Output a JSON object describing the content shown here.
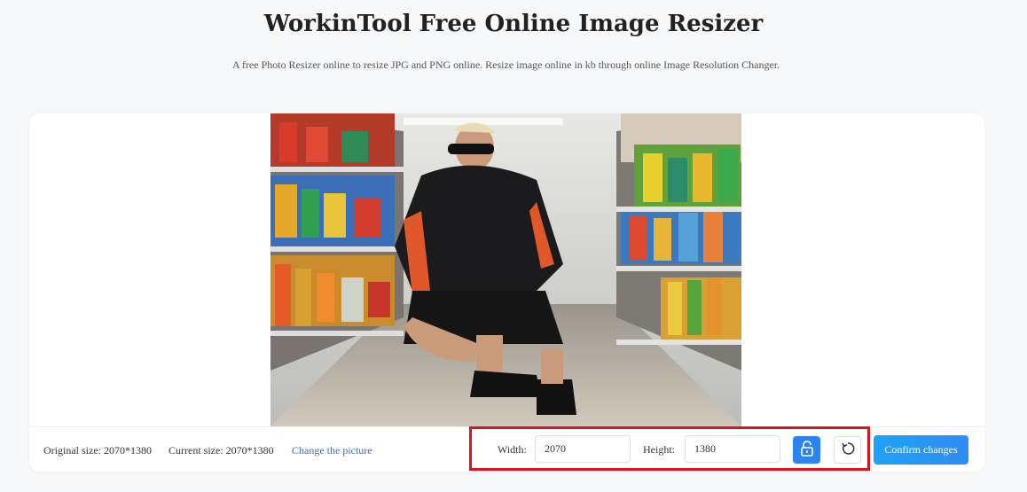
{
  "header": {
    "title": "WorkinTool Free Online Image Resizer",
    "subtitle": "A free Photo Resizer online to resize JPG and PNG online. Resize image online in kb through online Image Resolution Changer."
  },
  "preview": {
    "image_icon": "photo-preview"
  },
  "info": {
    "original_size": "Original size: 2070*1380",
    "current_size": "Current size: 2070*1380",
    "change_picture": "Change the picture"
  },
  "controls": {
    "width_label": "Width:",
    "width_value": "2070",
    "height_label": "Height:",
    "height_value": "1380",
    "lock_icon": "lock-icon",
    "reset_icon": "reset-icon",
    "confirm_label": "Confirm changes"
  },
  "colors": {
    "accent": "#2b83f6",
    "highlight": "#e0121b",
    "link": "#2f6fcf"
  }
}
